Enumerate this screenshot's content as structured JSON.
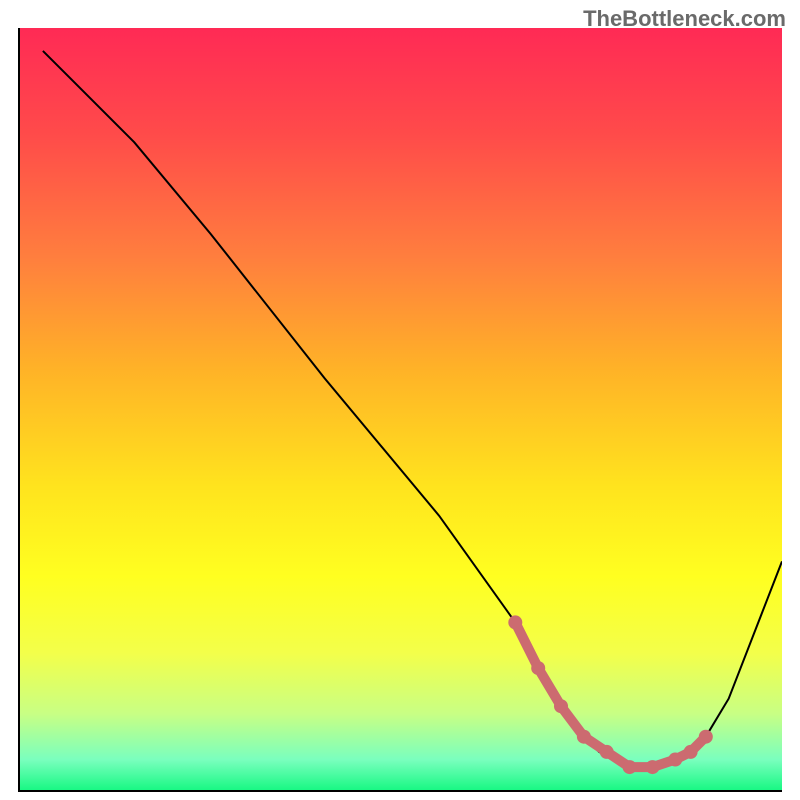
{
  "attribution": "TheBottleneck.com",
  "chart_data": {
    "type": "line",
    "title": "",
    "xlabel": "",
    "ylabel": "",
    "xlim": [
      0,
      100
    ],
    "ylim": [
      0,
      100
    ],
    "background_gradient": {
      "stops": [
        {
          "offset": 0.0,
          "color": "#ff2a55"
        },
        {
          "offset": 0.14,
          "color": "#ff4b4a"
        },
        {
          "offset": 0.3,
          "color": "#ff7e3e"
        },
        {
          "offset": 0.45,
          "color": "#ffb327"
        },
        {
          "offset": 0.6,
          "color": "#ffe31e"
        },
        {
          "offset": 0.72,
          "color": "#ffff20"
        },
        {
          "offset": 0.82,
          "color": "#f3ff4a"
        },
        {
          "offset": 0.9,
          "color": "#c8ff84"
        },
        {
          "offset": 0.96,
          "color": "#7affbe"
        },
        {
          "offset": 1.0,
          "color": "#19f884"
        }
      ]
    },
    "series": [
      {
        "name": "bottleneck-curve",
        "color": "#000000",
        "x": [
          3,
          6,
          10,
          15,
          25,
          40,
          55,
          65,
          70,
          73,
          76,
          80,
          84,
          87,
          90,
          93,
          100
        ],
        "y": [
          97,
          94,
          90,
          85,
          73,
          54,
          36,
          22,
          13,
          8,
          5,
          3,
          3,
          4,
          7,
          12,
          30
        ]
      }
    ],
    "highlight": {
      "name": "optimal-zone",
      "color": "#cc6b70",
      "x": [
        65,
        68,
        71,
        74,
        77,
        80,
        83,
        86,
        88,
        90
      ],
      "y": [
        22,
        16,
        11,
        7,
        5,
        3,
        3,
        4,
        5,
        7
      ]
    }
  }
}
